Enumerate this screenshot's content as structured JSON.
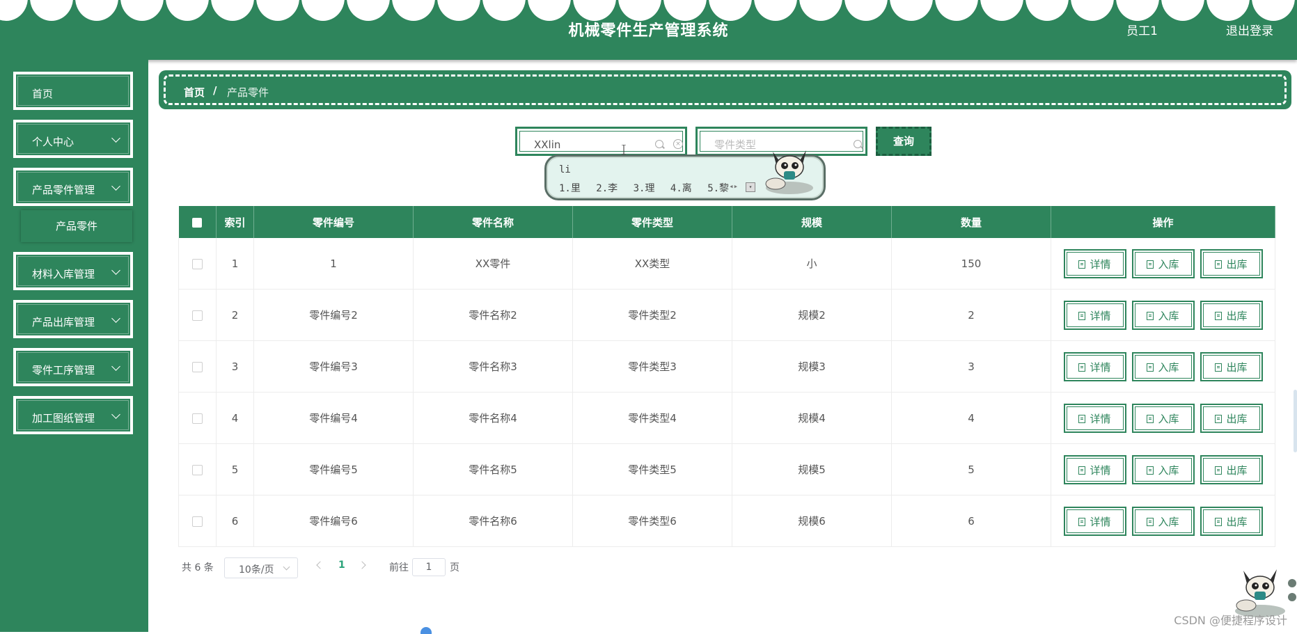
{
  "header": {
    "title": "机械零件生产管理系统",
    "user": "员工1",
    "logout": "退出登录"
  },
  "sidebar": {
    "items": [
      {
        "label": "首页",
        "has_chevron": false
      },
      {
        "label": "个人中心",
        "has_chevron": true
      },
      {
        "label": "产品零件管理",
        "has_chevron": true
      },
      {
        "label": "材料入库管理",
        "has_chevron": true
      },
      {
        "label": "产品出库管理",
        "has_chevron": true
      },
      {
        "label": "零件工序管理",
        "has_chevron": true
      },
      {
        "label": "加工图纸管理",
        "has_chevron": true
      }
    ],
    "sub_item": "产品零件"
  },
  "breadcrumb": {
    "home": "首页",
    "separator": "/",
    "current": "产品零件"
  },
  "search": {
    "name_value": "XXlin",
    "type_placeholder": "零件类型",
    "query_label": "查询"
  },
  "ime": {
    "pinyin": "li",
    "candidates": [
      "1.里",
      "2.李",
      "3.理",
      "4.离",
      "5.黎"
    ]
  },
  "table": {
    "columns": [
      "索引",
      "零件编号",
      "零件名称",
      "零件类型",
      "规模",
      "数量",
      "操作"
    ],
    "rows": [
      {
        "index": "1",
        "code": "1",
        "name": "XX零件",
        "type": "XX类型",
        "scale": "小",
        "qty": "150"
      },
      {
        "index": "2",
        "code": "零件编号2",
        "name": "零件名称2",
        "type": "零件类型2",
        "scale": "规模2",
        "qty": "2"
      },
      {
        "index": "3",
        "code": "零件编号3",
        "name": "零件名称3",
        "type": "零件类型3",
        "scale": "规模3",
        "qty": "3"
      },
      {
        "index": "4",
        "code": "零件编号4",
        "name": "零件名称4",
        "type": "零件类型4",
        "scale": "规模4",
        "qty": "4"
      },
      {
        "index": "5",
        "code": "零件编号5",
        "name": "零件名称5",
        "type": "零件类型5",
        "scale": "规模5",
        "qty": "5"
      },
      {
        "index": "6",
        "code": "零件编号6",
        "name": "零件名称6",
        "type": "零件类型6",
        "scale": "规模6",
        "qty": "6"
      }
    ],
    "actions": {
      "detail": "详情",
      "stock_in": "入库",
      "stock_out": "出库"
    }
  },
  "pagination": {
    "total": "共 6 条",
    "page_size": "10条/页",
    "current_page": "1",
    "goto_label": "前往",
    "goto_value": "1",
    "page_suffix": "页"
  },
  "watermark": "CSDN @便捷程序设计",
  "colors": {
    "primary": "#2e855c",
    "page_active": "#2ba37a",
    "background": "#ffffff"
  }
}
